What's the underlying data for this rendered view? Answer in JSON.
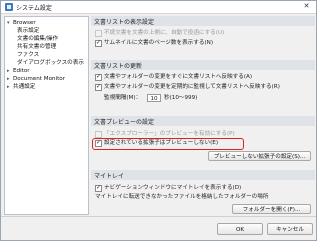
{
  "window": {
    "title": "システム設定",
    "close_glyph": "✕"
  },
  "tree": {
    "items": [
      {
        "label": "Browser",
        "expander": "▾",
        "level": 0
      },
      {
        "label": "表示設定",
        "level": 1
      },
      {
        "label": "文書の編集/操作",
        "level": 1
      },
      {
        "label": "共有文書の管理",
        "level": 1
      },
      {
        "label": "ファクス",
        "level": 1
      },
      {
        "label": "ダイアログボックスの表示",
        "level": 1
      },
      {
        "label": "Editor",
        "expander": "▸",
        "level": 0
      },
      {
        "label": "Document Monitor",
        "expander": "▸",
        "level": 0
      },
      {
        "label": "共通設定",
        "expander": "▸",
        "level": 0
      }
    ]
  },
  "sections": {
    "doc_list_display": {
      "header": "文書リストの表示設定",
      "options": [
        {
          "label": "不読文書を文書の上側に、自動で投函にする(U)",
          "checked": false,
          "disabled": true
        },
        {
          "label": "サムネイルに文書のページ数を表示する(N)",
          "checked": true,
          "disabled": false
        }
      ]
    },
    "doc_list_update": {
      "header": "文書リストの更新",
      "options": [
        {
          "label": "文書やフォルダーの変更をすぐに文書リストへ反映する(A)",
          "checked": true
        },
        {
          "label": "文書やフォルダーの変更を定期的に監視して文書リストへ反映する(R)",
          "checked": true
        }
      ],
      "interval_label": "監視間隔(M)：",
      "interval_value": "10",
      "interval_unit": "秒(10〜999)"
    },
    "doc_preview": {
      "header": "文書プレビューの設定",
      "options": [
        {
          "label": "「エクスプローラー」のプレビューを有効にする(P)",
          "checked": false,
          "disabled": true
        },
        {
          "label": "設定されている拡張子はプレビューしない(E)",
          "checked": true,
          "disabled": false
        }
      ],
      "button_label": "プレビューしない拡張子の設定(S)..."
    },
    "mytray": {
      "header": "マイトレイ",
      "options": [
        {
          "label": "ナビゲーションウィンドウにマイトレイを表示する(D)",
          "checked": true
        }
      ],
      "note": "マイトレイに転送できなかったファイルを格納したフォルダーの場所",
      "button_label": "フォルダーを開く(F)..."
    }
  },
  "footer": {
    "ok_label": "OK",
    "cancel_label": "キャンセル"
  },
  "colors": {
    "highlight": "#e0201c",
    "section_header_bg": "#dfe3e8"
  }
}
